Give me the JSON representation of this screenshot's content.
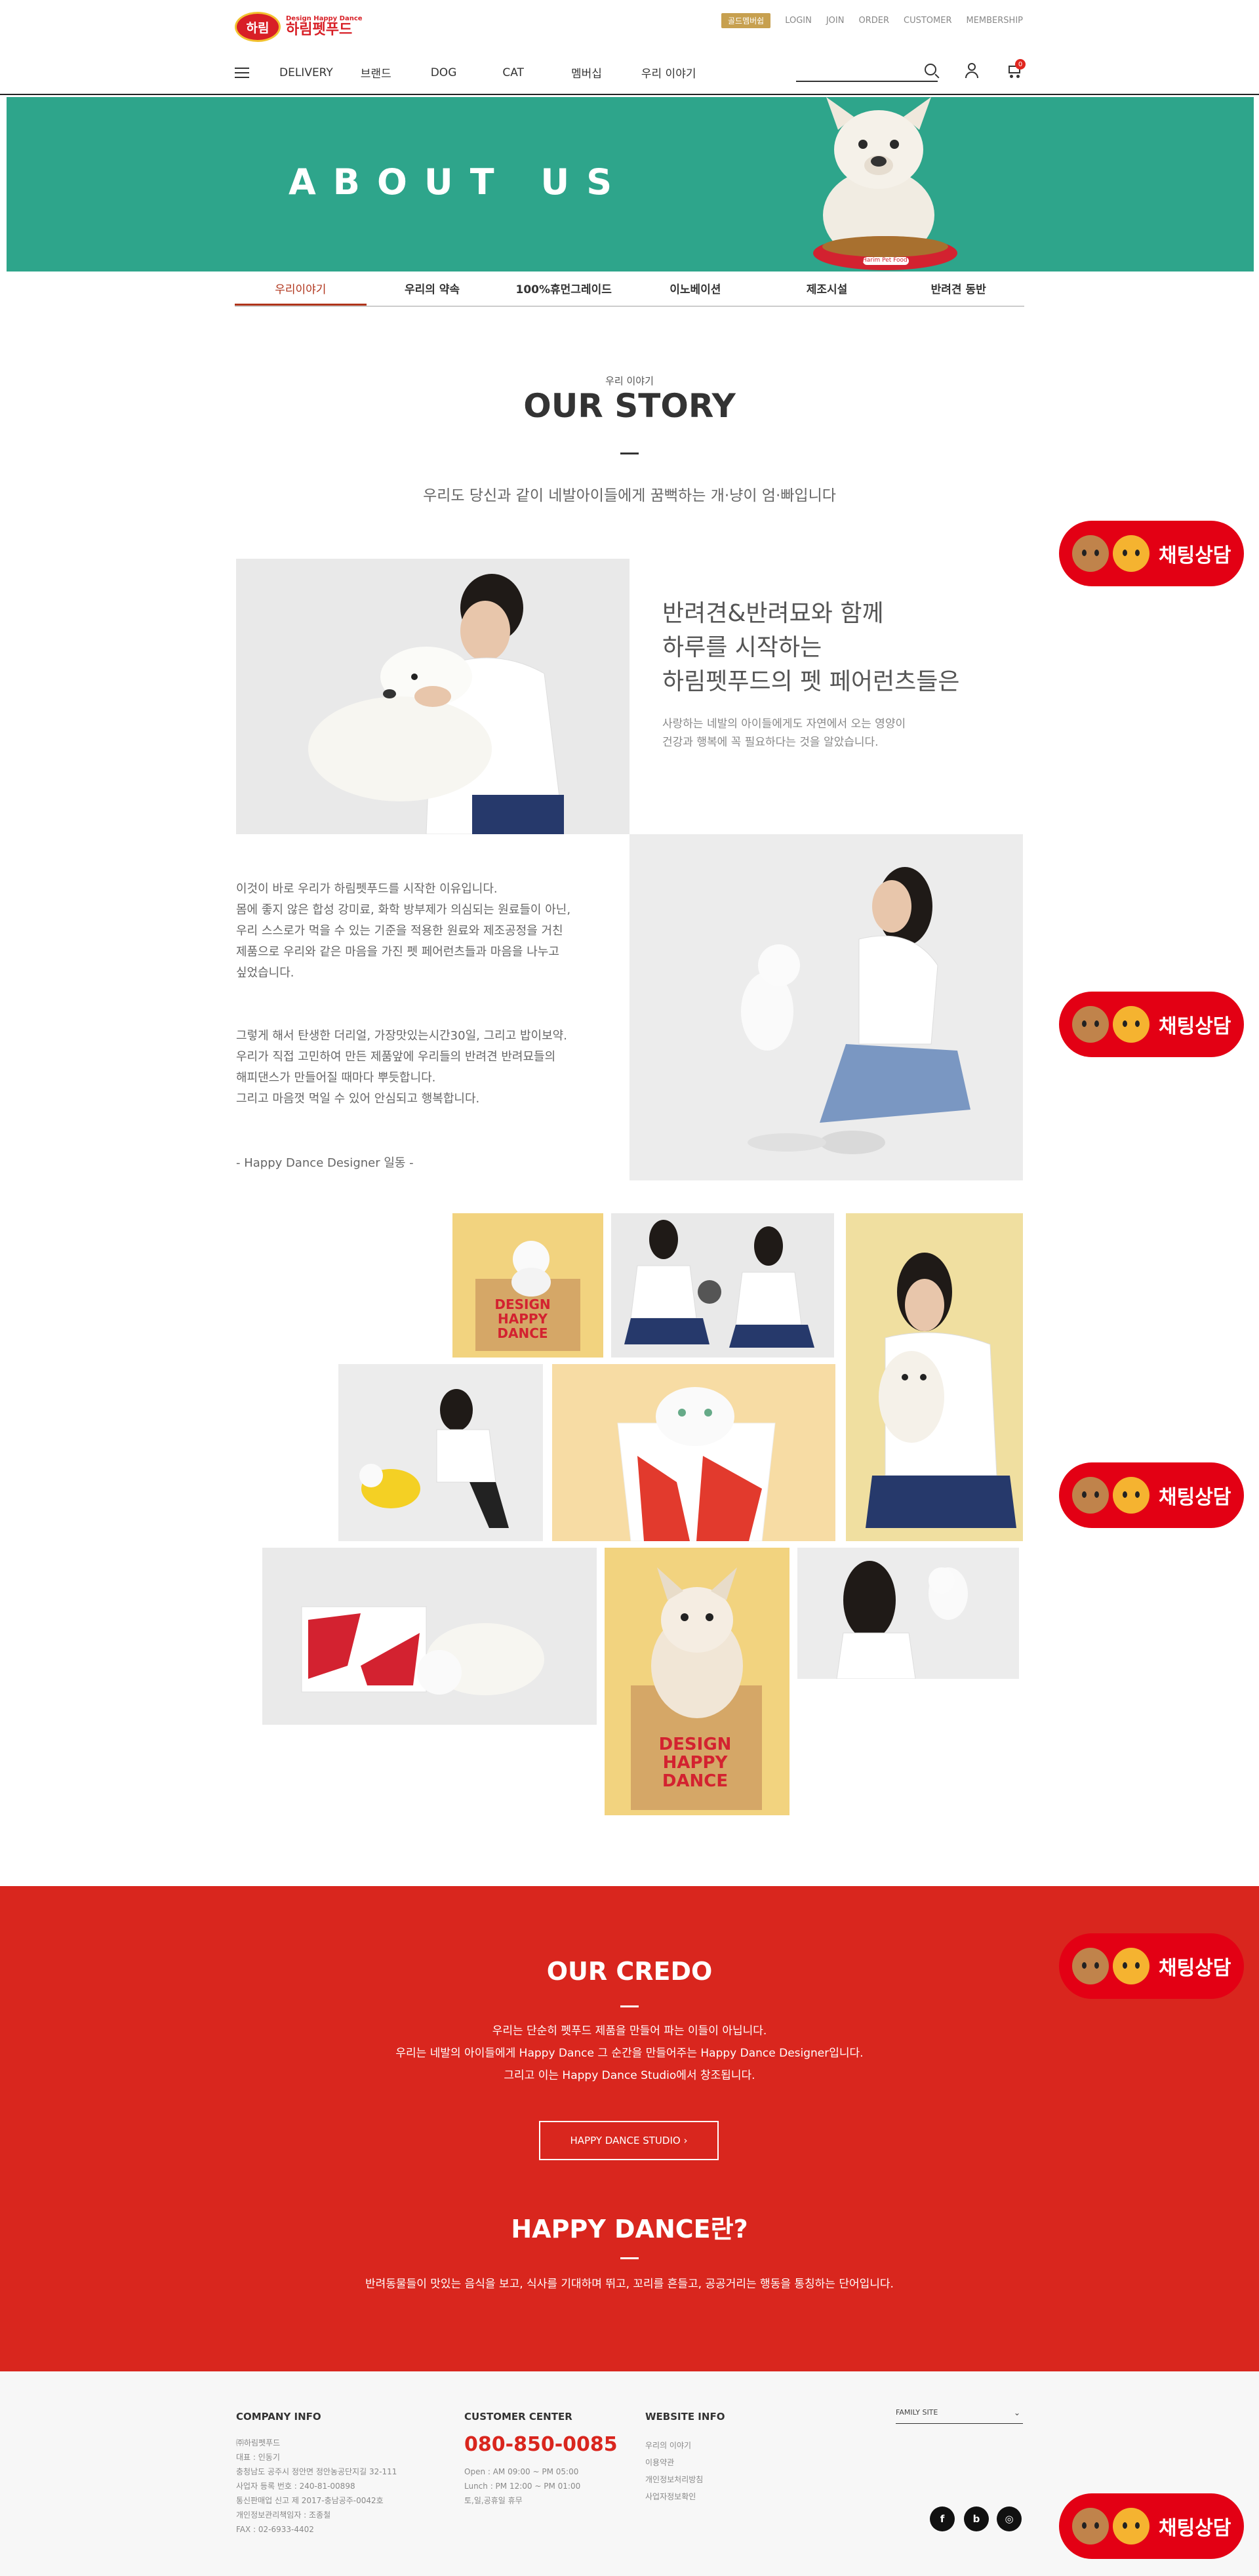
{
  "header": {
    "logo_oval": "하림",
    "logo_small": "Design Happy Dance",
    "logo_big": "하림펫푸드",
    "gold_badge": "골드멤버쉽",
    "util_links": [
      "LOGIN",
      "JOIN",
      "ORDER",
      "CUSTOMER",
      "MEMBERSHIP"
    ],
    "nav": [
      "DELIVERY",
      "브랜드",
      "DOG",
      "CAT",
      "멤버십",
      "우리 이야기"
    ],
    "cart_count": "0"
  },
  "banner": {
    "title": "ABOUT US",
    "bowl_text": "Harim Pet Food"
  },
  "tabs": [
    "우리이야기",
    "우리의 약속",
    "100%휴먼그레이드",
    "이노베이션",
    "제조시설",
    "반려견 동반"
  ],
  "story": {
    "eyebrow": "우리 이야기",
    "title": "OUR STORY",
    "subtitle": "우리도 당신과 같이 네발아이들에게 꿈뻑하는 개·냥이 엄·빠입니다",
    "heading_lines": [
      "반려견&반려묘와 함께",
      "하루를 시작하는",
      "하림펫푸드의 펫 페어런츠들은"
    ],
    "desc_lines": [
      "사랑하는 네발의 아이들에게도 자연에서 오는 영양이",
      "건강과 행복에 꼭 필요하다는 것을 알았습니다."
    ],
    "para1": [
      "이것이 바로 우리가 하림펫푸드를 시작한 이유입니다.",
      "몸에 좋지 않은 합성 강미료, 화학 방부제가 의심되는 원료들이 아닌,",
      "우리 스스로가 먹을 수 있는 기준을 적용한 원료와 제조공정을 거친",
      "제품으로 우리와 같은 마음을 가진 펫 페어런츠들과 마음을 나누고",
      "싶었습니다."
    ],
    "para2": [
      "그렇게 해서 탄생한 더리얼, 가장맛있는시간30일, 그리고 밥이보약.",
      "우리가 직접 고민하여 만든 제품앞에 우리들의 반려견 반려묘들의",
      "해피댄스가 만들어질 때마다 뿌듯합니다.",
      "그리고 마음껏 먹일 수 있어 안심되고 행복합니다."
    ],
    "signature": "- Happy Dance Designer 일동 -",
    "box_text": [
      "DESIGN",
      "HAPPY",
      "DANCE"
    ]
  },
  "credo": {
    "title": "OUR CREDO",
    "lines": [
      "우리는 단순히 펫푸드 제품을 만들어 파는 이들이 아닙니다.",
      "우리는 네발의 아이들에게 Happy Dance 그 순간을 만들어주는 Happy Dance Designer입니다.",
      "그리고 이는 Happy Dance Studio에서 창조됩니다."
    ],
    "button": "HAPPY DANCE STUDIO  ›",
    "title2": "HAPPY DANCE란?",
    "line2": "반려동물들이 맛있는 음식을 보고, 식사를 기대하며 뛰고, 꼬리를 흔들고, 공공거리는 행동을 통칭하는 단어입니다."
  },
  "footer": {
    "company_title": "COMPANY INFO",
    "company_lines": [
      "㈜하림펫푸드",
      "대표 : 인동기",
      "충청남도 공주시 정안면 정안농공단지길 32-111",
      "사업자 등록 번호 : 240-81-00898",
      "통신판매업 신고 제 2017-충남공주-0042호",
      "개인정보관리책임자 : 조종철",
      "FAX : 02-6933-4402"
    ],
    "cs_title": "CUSTOMER CENTER",
    "cs_phone": "080-850-0085",
    "cs_lines": [
      "Open : AM 09:00 ~ PM 05:00",
      "Lunch : PM 12:00 ~ PM 01:00",
      "토,일,공휴일 휴무"
    ],
    "web_title": "WEBSITE INFO",
    "web_links": [
      "우리의 이야기",
      "이용약관",
      "개인정보처리방침",
      "사업자정보확인"
    ],
    "family_site": "FAMILY SITE",
    "social": [
      "f",
      "b",
      "◎"
    ]
  },
  "chat": {
    "label": "채팅상담"
  },
  "colors": {
    "teal": "#2ea58b",
    "red": "#d9261e",
    "tab_active": "#b0341b",
    "chat_red": "#e30014",
    "gold": "#c7a04f"
  }
}
